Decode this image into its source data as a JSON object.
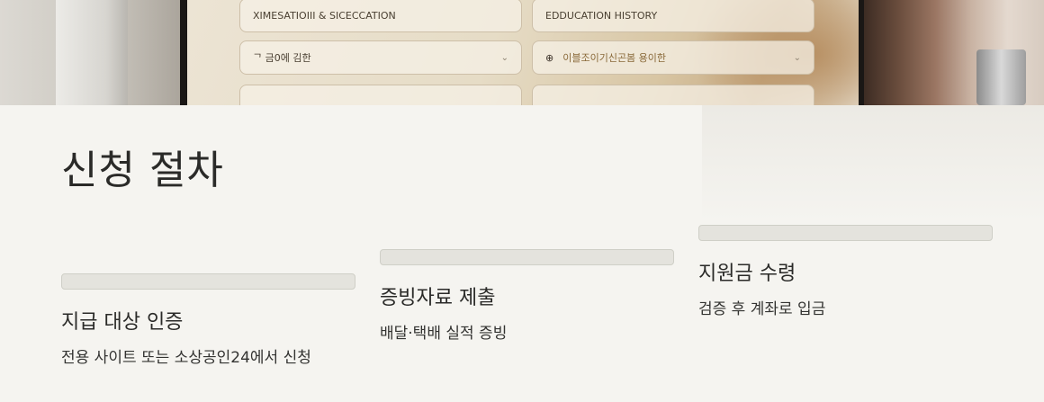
{
  "hero": {
    "screen_fields": [
      {
        "label": "XIMESATIOIII & SICECCATION",
        "icon": "none",
        "chevron": false
      },
      {
        "label": "EDDUCATION HISTORY",
        "icon": "none",
        "chevron": false
      },
      {
        "label": "ᄀ 금0에 김한",
        "icon": "tag-icon",
        "chevron": true
      },
      {
        "label": "이블조이기신곤봄 용이한",
        "icon": "person-icon",
        "chevron": true
      }
    ]
  },
  "section": {
    "title": "신청 절차",
    "steps": [
      {
        "title": "지급 대상 인증",
        "description": "전용 사이트 또는 소상공인24에서 신청"
      },
      {
        "title": "증빙자료 제출",
        "description": "배달·택배 실적 증빙"
      },
      {
        "title": "지원금 수령",
        "description": "검증 후 계좌로 입금"
      }
    ]
  },
  "colors": {
    "background": "#f5f4f0",
    "text": "#2a2a28",
    "step_bar": "#e4e3dd"
  }
}
